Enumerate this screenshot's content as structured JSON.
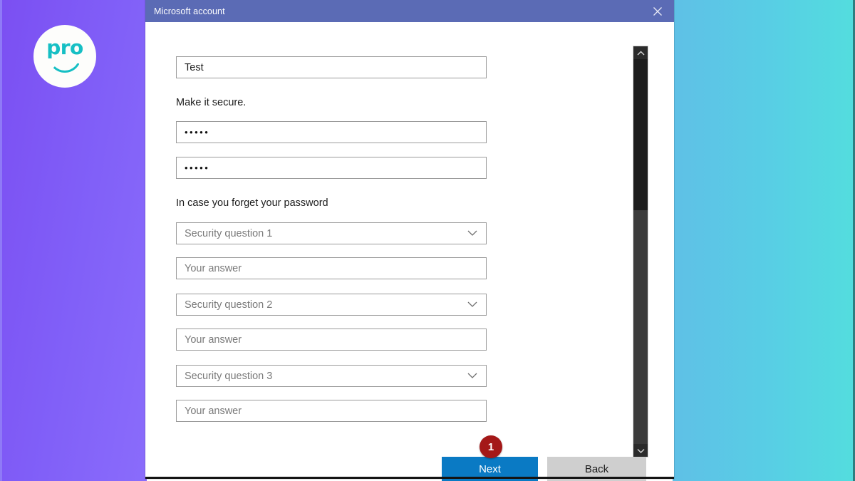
{
  "desktop": {
    "logo": {
      "text": "pro",
      "accent_color": "#16bfc4",
      "circle_color": "#fdfdfb"
    },
    "background": {
      "left_gradient_from": "#7b4ff2",
      "left_gradient_to": "#8a6cfb",
      "right_gradient_from": "#5fc0e6",
      "right_gradient_to": "#53ddde"
    }
  },
  "dialog": {
    "title": "Microsoft account",
    "titlebar_color": "#5b6bb5",
    "close_icon": "close-icon",
    "form": {
      "name_field": {
        "value": "Test",
        "placeholder": ""
      },
      "secure_label": "Make it secure.",
      "password_field": {
        "value": "•••••",
        "placeholder": ""
      },
      "password_confirm_field": {
        "value": "•••••",
        "placeholder": ""
      },
      "forgot_label": "In case you forget your password",
      "security": [
        {
          "question_label": "Security question 1",
          "answer_placeholder": "Your answer",
          "answer_value": ""
        },
        {
          "question_label": "Security question 2",
          "answer_placeholder": "Your answer",
          "answer_value": ""
        },
        {
          "question_label": "Security question 3",
          "answer_placeholder": "Your answer",
          "answer_value": ""
        }
      ]
    },
    "scrollbar": {
      "up_icon": "chevron-up-icon",
      "down_icon": "chevron-down-icon"
    },
    "footer": {
      "next_label": "Next",
      "next_color": "#0a7ac4",
      "back_label": "Back",
      "back_color": "#cfcfcf",
      "badge_number": "1",
      "badge_color": "#a41818"
    }
  }
}
